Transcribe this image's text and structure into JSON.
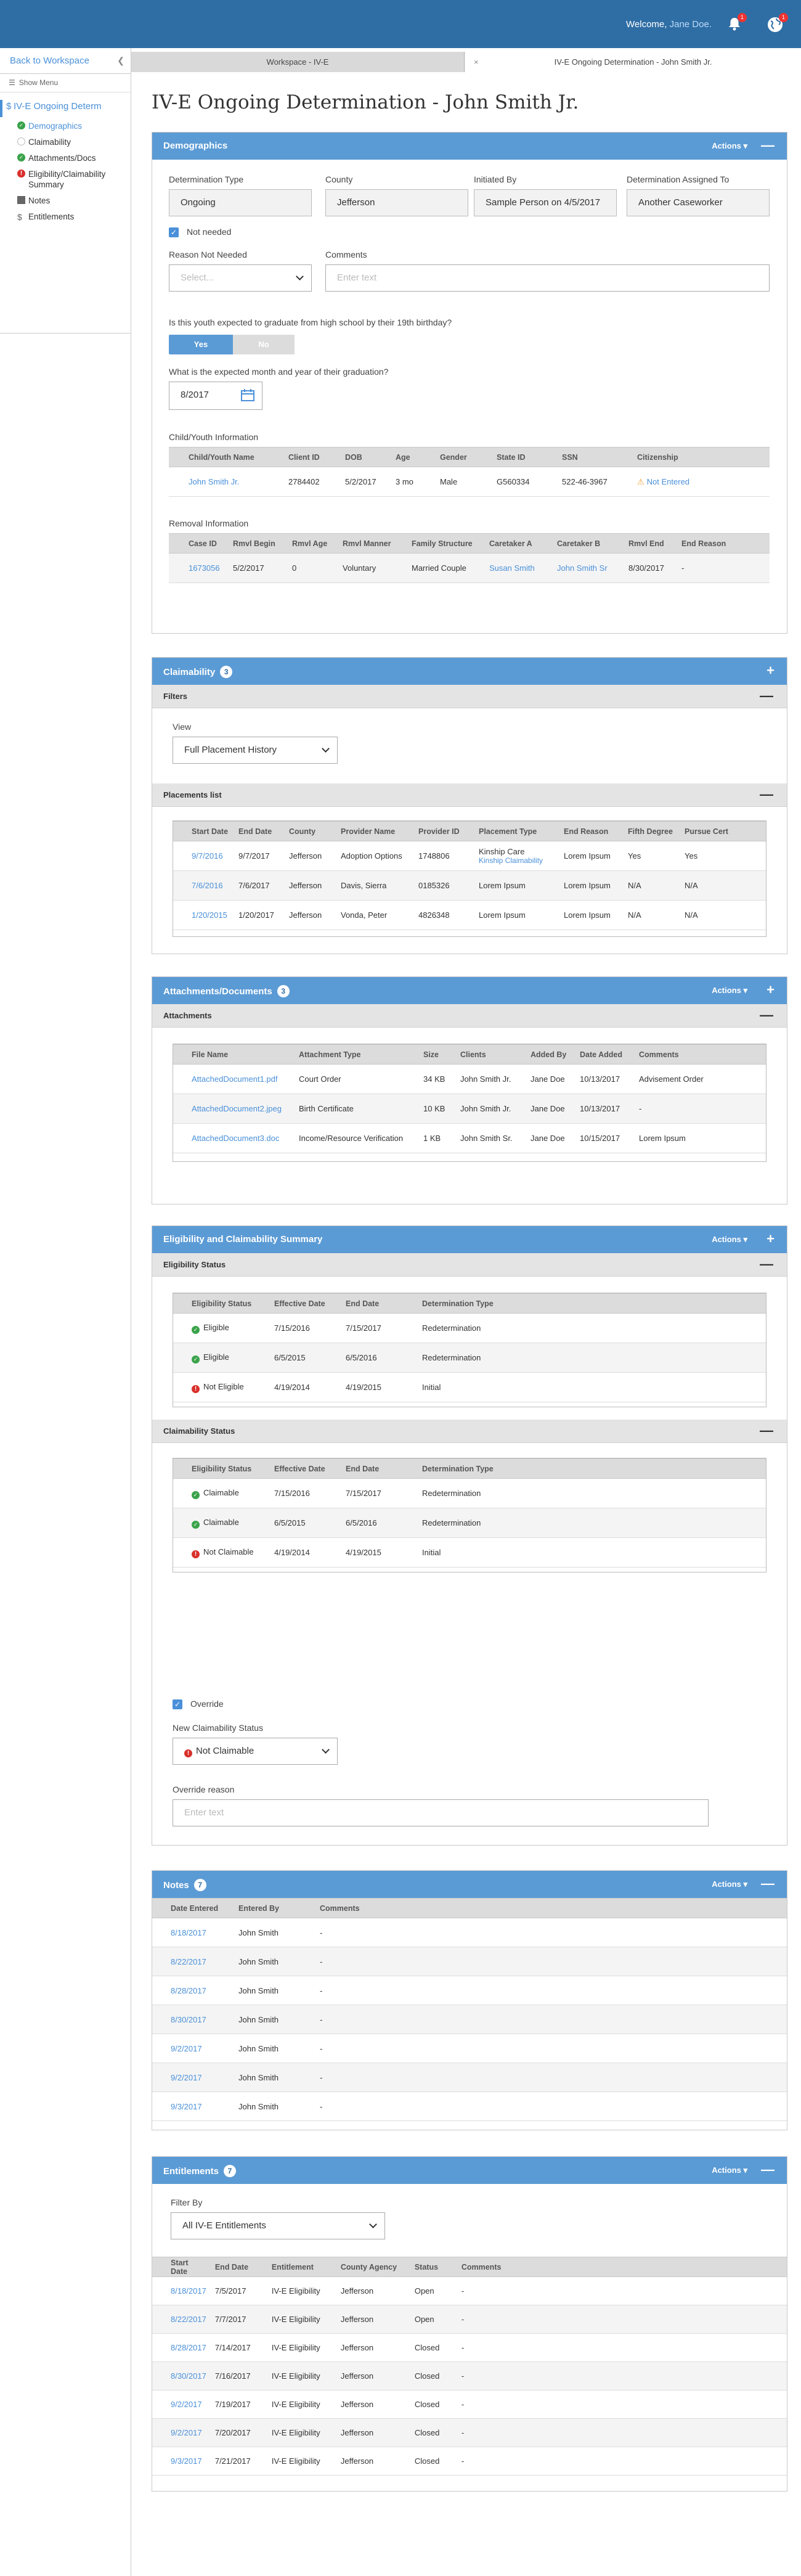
{
  "header": {
    "welcome_prefix": "Welcome, ",
    "user_name": "Jane Doe.",
    "bell_badge": "1",
    "globe_badge": "1"
  },
  "sidebar": {
    "back_label": "Back to Workspace",
    "show_menu": "Show Menu",
    "title": "IV-E Ongoing Determ",
    "items": [
      {
        "label": "Demographics"
      },
      {
        "label": "Claimability"
      },
      {
        "label": "Attachments/Docs"
      },
      {
        "label": "Eligibility/Claimability Summary"
      },
      {
        "label": "Notes"
      },
      {
        "label": "Entitlements"
      }
    ]
  },
  "tabs": [
    {
      "label": "Workspace - IV-E"
    },
    {
      "label": "IV-E Ongoing Determination - John Smith Jr."
    }
  ],
  "page_title": "IV-E Ongoing Determination - John Smith Jr.",
  "demographics": {
    "title": "Demographics",
    "actions": "Actions ▾",
    "det_type_label": "Determination Type",
    "det_type": "Ongoing",
    "county_label": "County",
    "county": "Jefferson",
    "initiated_label": "Initiated By",
    "initiated": "Sample Person on 4/5/2017",
    "assigned_label": "Determination Assigned To",
    "assigned": "Another Caseworker",
    "not_needed": "Not needed",
    "reason_label": "Reason Not Needed",
    "reason_placeholder": "Select...",
    "comments_label": "Comments",
    "comments_placeholder": "Enter text",
    "grad_question": "Is this youth expected to graduate from high school by their 19th birthday?",
    "yes": "Yes",
    "no": "No",
    "grad_date_question": "What is the expected month and year of their graduation?",
    "grad_date": "8/2017",
    "child_info_label": "Child/Youth Information",
    "child_cols": [
      "Child/Youth Name",
      "Client ID",
      "DOB",
      "Age",
      "Gender",
      "State ID",
      "SSN",
      "Citizenship"
    ],
    "child_row": [
      "John Smith Jr.",
      "2784402",
      "5/2/2017",
      "3 mo",
      "Male",
      "G560334",
      "522-46-3967",
      "Not Entered"
    ],
    "removal_label": "Removal Information",
    "removal_cols": [
      "Case ID",
      "Rmvl Begin",
      "Rmvl Age",
      "Rmvl Manner",
      "Family Structure",
      "Caretaker A",
      "Caretaker B",
      "Rmvl End",
      "End Reason"
    ],
    "removal_row": [
      "1673056",
      "5/2/2017",
      "0",
      "Voluntary",
      "Married Couple",
      "Susan Smith",
      "John Smith Sr",
      "8/30/2017",
      "-"
    ]
  },
  "claimability": {
    "title": "Claimability",
    "count": "3",
    "filters": "Filters",
    "view_label": "View",
    "view_value": "Full Placement History",
    "placements": "Placements list",
    "cols": [
      "Start Date",
      "End Date",
      "County",
      "Provider Name",
      "Provider ID",
      "Placement Type",
      "End Reason",
      "Fifth Degree",
      "Pursue Cert"
    ],
    "rows": [
      [
        "9/7/2016",
        "9/7/2017",
        "Jefferson",
        "Adoption Options",
        "1748806",
        "Kinship Care",
        "Lorem Ipsum",
        "Yes",
        "Yes"
      ],
      [
        "7/6/2016",
        "7/6/2017",
        "Jefferson",
        "Davis, Sierra",
        "0185326",
        "Lorem Ipsum",
        "Lorem Ipsum",
        "N/A",
        "N/A"
      ],
      [
        "1/20/2015",
        "1/20/2017",
        "Jefferson",
        "Vonda, Peter",
        "4826348",
        "Lorem Ipsum",
        "Lorem Ipsum",
        "N/A",
        "N/A"
      ]
    ],
    "kinship_link": "Kinship Claimability"
  },
  "attachments": {
    "title": "Attachments/Documents",
    "count": "3",
    "actions": "Actions ▾",
    "sub": "Attachments",
    "cols": [
      "File Name",
      "Attachment Type",
      "Size",
      "Clients",
      "Added By",
      "Date Added",
      "Comments"
    ],
    "rows": [
      [
        "AttachedDocument1.pdf",
        "Court Order",
        "34 KB",
        "John Smith Jr.",
        "Jane Doe",
        "10/13/2017",
        "Advisement Order"
      ],
      [
        "AttachedDocument2.jpeg",
        "Birth Certificate",
        "10 KB",
        "John Smith Jr.",
        "Jane Doe",
        "10/13/2017",
        "-"
      ],
      [
        "AttachedDocument3.doc",
        "Income/Resource Verification",
        "1 KB",
        "John Smith Sr.",
        "Jane Doe",
        "10/15/2017",
        "Lorem Ipsum"
      ]
    ]
  },
  "summary": {
    "title": "Eligibility and Claimability Summary",
    "actions": "Actions ▾",
    "elig_sub": "Eligibility Status",
    "elig_cols": [
      "Eligibility Status",
      "Effective Date",
      "End Date",
      "Determination Type"
    ],
    "elig_rows": [
      [
        "Eligible",
        "7/15/2016",
        "7/15/2017",
        "Redetermination"
      ],
      [
        "Eligible",
        "6/5/2015",
        "6/5/2016",
        "Redetermination"
      ],
      [
        "Not Eligible",
        "4/19/2014",
        "4/19/2015",
        "Initial"
      ]
    ],
    "claim_sub": "Claimability Status",
    "claim_cols": [
      "Eligibility Status",
      "Effective Date",
      "End Date",
      "Determination Type"
    ],
    "claim_rows": [
      [
        "Claimable",
        "7/15/2016",
        "7/15/2017",
        "Redetermination"
      ],
      [
        "Claimable",
        "6/5/2015",
        "6/5/2016",
        "Redetermination"
      ],
      [
        "Not Claimable",
        "4/19/2014",
        "4/19/2015",
        "Initial"
      ]
    ],
    "override": "Override",
    "new_status_label": "New Claimability Status",
    "new_status": "Not Claimable",
    "override_reason_label": "Override reason",
    "override_placeholder": "Enter text"
  },
  "notes": {
    "title": "Notes",
    "count": "7",
    "actions": "Actions ▾",
    "cols": [
      "Date Entered",
      "Entered By",
      "Comments"
    ],
    "rows": [
      [
        "8/18/2017",
        "John Smith",
        "-"
      ],
      [
        "8/22/2017",
        "John Smith",
        "-"
      ],
      [
        "8/28/2017",
        "John Smith",
        "-"
      ],
      [
        "8/30/2017",
        "John Smith",
        "-"
      ],
      [
        "9/2/2017",
        "John Smith",
        "-"
      ],
      [
        "9/2/2017",
        "John Smith",
        "-"
      ],
      [
        "9/3/2017",
        "John Smith",
        "-"
      ]
    ]
  },
  "entitlements": {
    "title": "Entitlements",
    "count": "7",
    "actions": "Actions ▾",
    "filter_label": "Filter By",
    "filter_value": "All IV-E Entitlements",
    "cols": [
      "Start Date",
      "End Date",
      "Entitlement",
      "County Agency",
      "Status",
      "Comments"
    ],
    "rows": [
      [
        "8/18/2017",
        "7/5/2017",
        "IV-E Eligibility",
        "Jefferson",
        "Open",
        "-"
      ],
      [
        "8/22/2017",
        "7/7/2017",
        "IV-E Eligibility",
        "Jefferson",
        "Open",
        "-"
      ],
      [
        "8/28/2017",
        "7/14/2017",
        "IV-E Eligibility",
        "Jefferson",
        "Closed",
        "-"
      ],
      [
        "8/30/2017",
        "7/16/2017",
        "IV-E Eligibility",
        "Jefferson",
        "Closed",
        "-"
      ],
      [
        "9/2/2017",
        "7/19/2017",
        "IV-E Eligibility",
        "Jefferson",
        "Closed",
        "-"
      ],
      [
        "9/2/2017",
        "7/20/2017",
        "IV-E Eligibility",
        "Jefferson",
        "Closed",
        "-"
      ],
      [
        "9/3/2017",
        "7/21/2017",
        "IV-E Eligibility",
        "Jefferson",
        "Closed",
        "-"
      ]
    ]
  }
}
